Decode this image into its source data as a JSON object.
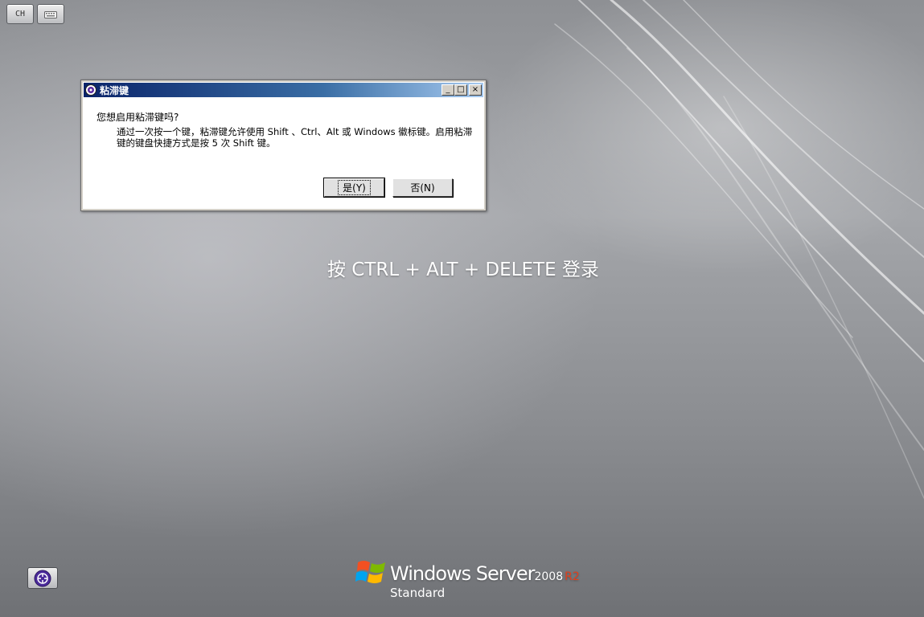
{
  "toolbar": {
    "language_label": "CH"
  },
  "dialog": {
    "title": "粘滞键",
    "question": "您想启用粘滞键吗?",
    "description": "通过一次按一个键，粘滞键允许使用 Shift 、Ctrl、Alt 或 Windows 徽标键。启用粘滞键的键盘快捷方式是按 5 次 Shift 键。",
    "minimize_label": "_",
    "maximize_label": "□",
    "close_label": "×",
    "yes_label": "是(Y)",
    "no_label": "否(N)"
  },
  "login": {
    "prompt": "按 CTRL + ALT + DELETE 登录"
  },
  "branding": {
    "product_name": "Windows Server",
    "version": "2008",
    "release": "R2",
    "edition": "Standard",
    "release_color": "#e2401d"
  },
  "icons": {
    "language": "language-indicator-icon",
    "keyboard": "keyboard-icon",
    "ease_of_access": "ease-of-access-icon",
    "windows_logo": "windows-flag-logo"
  }
}
